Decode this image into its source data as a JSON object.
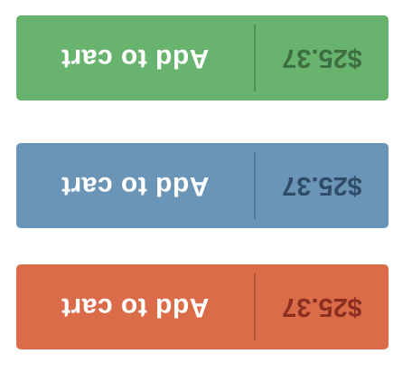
{
  "buttons": [
    {
      "label": "Add to cart",
      "price": "$25.37",
      "colors": {
        "background": "#68b46f",
        "divider": "#4f9356",
        "price_text": "#3d6f42"
      }
    },
    {
      "label": "Add to cart",
      "price": "$25.37",
      "colors": {
        "background": "#6b95b7",
        "divider": "#54799a",
        "price_text": "#2f4d69"
      }
    },
    {
      "label": "Add to cart",
      "price": "$25.37",
      "colors": {
        "background": "#db6c4a",
        "divider": "#b55337",
        "price_text": "#8c2f1f"
      }
    }
  ]
}
